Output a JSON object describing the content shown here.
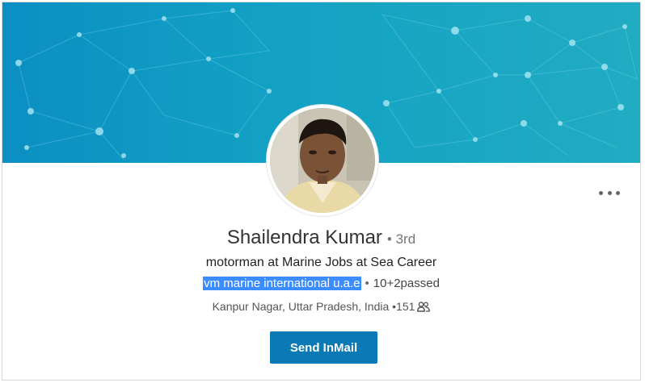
{
  "profile": {
    "name": "Shailendra Kumar",
    "degree": "• 3rd",
    "headline": "motorman at Marine Jobs at Sea Career",
    "company": "vm marine international u.a.e",
    "separator": "•",
    "school": "10+2passed",
    "location": "Kanpur Nagar, Uttar Pradesh, India",
    "connections": "•151"
  },
  "actions": {
    "send_inmail": "Send InMail"
  },
  "icons": {
    "more": "more-options-icon",
    "connections": "people-icon"
  },
  "colors": {
    "banner_start": "#0b8fc3",
    "banner_end": "#21acc2",
    "button": "#0a79b5",
    "highlight": "#3b8dff"
  }
}
